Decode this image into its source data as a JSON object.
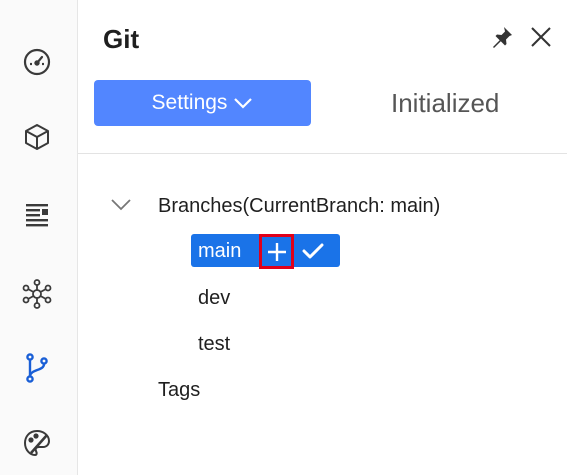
{
  "panel": {
    "title": "Git",
    "settings_label": "Settings",
    "status": "Initialized"
  },
  "tree": {
    "branches_label": "Branches(CurrentBranch: main)",
    "branches": [
      {
        "name": "main",
        "current": true
      },
      {
        "name": "dev"
      },
      {
        "name": "test"
      }
    ],
    "tags_label": "Tags"
  },
  "icons": {
    "activity": [
      "dashboard-icon",
      "cube-icon",
      "document-list-icon",
      "network-graph-icon",
      "git-branch-icon",
      "paint-palette-icon"
    ],
    "header": [
      "pin-icon",
      "close-icon"
    ],
    "branch_actions": [
      "plus-icon",
      "check-icon"
    ]
  },
  "colors": {
    "primary": "#5286ff",
    "selected": "#1a73e8",
    "highlight": "#e0001a",
    "active_icon": "#1a5fd6"
  }
}
